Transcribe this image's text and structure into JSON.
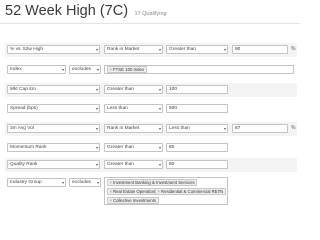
{
  "header": {
    "title": "52 Week High (7C)",
    "subtitle": "17 Qualifying"
  },
  "rows": {
    "r1": {
      "field": "% vs. 52w High",
      "mode": "Rank in Market",
      "op": "Greater than",
      "value": "90",
      "unit": "%"
    },
    "r2": {
      "field": "Index",
      "mode": "excludes",
      "tags": [
        "FTSE 100 Index"
      ]
    },
    "r3": {
      "field": "Mkt Cap £m",
      "op": "Greater than",
      "value": "100"
    },
    "r4": {
      "field": "Spread (bps)",
      "op": "Less than",
      "value": "500"
    },
    "r5": {
      "field": "3m Avg Vol",
      "mode": "Rank in Market",
      "op": "Less than",
      "value": "67",
      "unit": "%"
    },
    "r6": {
      "field": "Momentum Rank",
      "op": "Greater than",
      "value": "60"
    },
    "r7": {
      "field": "Quality Rank",
      "op": "Greater than",
      "value": "60"
    },
    "r8": {
      "field": "Industry Group",
      "mode": "excludes",
      "tags": [
        "Investment Banking & Investment Services",
        "Real Estate Operations",
        "Residential & Commercial REITs",
        "Collective Investments"
      ]
    }
  },
  "icons": {
    "dropdown": "chevron-down-icon",
    "remove_tag": "x-icon"
  }
}
